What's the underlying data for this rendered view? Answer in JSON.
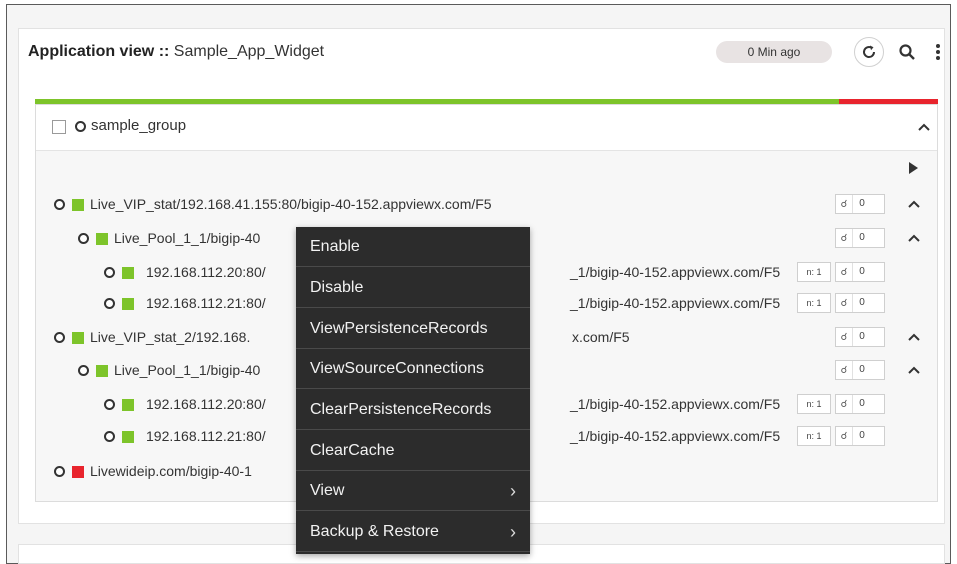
{
  "header": {
    "title_bold": "Application view ::",
    "title_name": "Sample_App_Widget",
    "last_updated": "0 Min ago"
  },
  "status_colors": {
    "up": "#7dc42a",
    "down": "#e8242d"
  },
  "group": {
    "name": "sample_group"
  },
  "tree": [
    {
      "label": "Live_VIP_stat/192.168.41.155:80/bigip-40-152.appviewx.com/F5",
      "status": "up",
      "count": "0"
    },
    {
      "label": "Live_Pool_1_1/bigip-40",
      "status": "up",
      "count": "0"
    },
    {
      "label": "192.168.112.20:80/",
      "suffix": "_1/bigip-40-152.appviewx.com/F5",
      "status": "up",
      "n": "n: 1",
      "count": "0"
    },
    {
      "label": "192.168.112.21:80/",
      "suffix": "_1/bigip-40-152.appviewx.com/F5",
      "status": "up",
      "n": "n: 1",
      "count": "0"
    },
    {
      "label": "Live_VIP_stat_2/192.168.",
      "suffix": "x.com/F5",
      "status": "up",
      "count": "0"
    },
    {
      "label": "Live_Pool_1_1/bigip-40",
      "status": "up",
      "count": "0"
    },
    {
      "label": "192.168.112.20:80/",
      "suffix": "_1/bigip-40-152.appviewx.com/F5",
      "status": "up",
      "n": "n: 1",
      "count": "0"
    },
    {
      "label": "192.168.112.21:80/",
      "suffix": "_1/bigip-40-152.appviewx.com/F5",
      "status": "up",
      "n": "n: 1",
      "count": "0"
    },
    {
      "label": "Livewideip.com/bigip-40-1",
      "status": "down"
    }
  ],
  "context_menu": [
    {
      "label": "Enable"
    },
    {
      "label": "Disable"
    },
    {
      "label": "ViewPersistenceRecords"
    },
    {
      "label": "ViewSourceConnections"
    },
    {
      "label": "ClearPersistenceRecords"
    },
    {
      "label": "ClearCache"
    },
    {
      "label": "View",
      "submenu": true
    },
    {
      "label": "Backup & Restore",
      "submenu": true
    }
  ],
  "icons": {
    "refresh": "refresh-icon",
    "search": "search-icon",
    "more": "more-vertical-icon",
    "collapse": "chevron-up-icon",
    "play": "play-icon",
    "submenu": "chevron-right-icon",
    "pin": "pin-icon"
  }
}
